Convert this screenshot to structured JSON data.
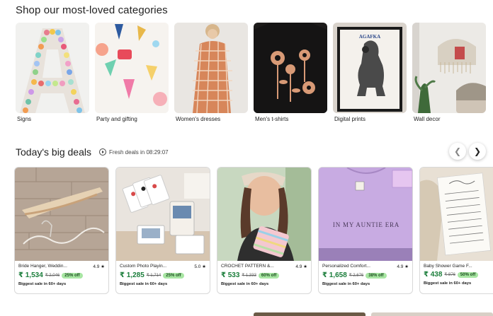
{
  "categories_section": {
    "title": "Shop our most-loved categories",
    "items": [
      {
        "label": "Signs"
      },
      {
        "label": "Party and gifting"
      },
      {
        "label": "Women's dresses"
      },
      {
        "label": "Men's t-shirts"
      },
      {
        "label": "Digital prints"
      },
      {
        "label": "Wall decor"
      }
    ]
  },
  "deals_section": {
    "title": "Today's big deals",
    "fresh_text": "Fresh deals in 08:29:07",
    "prev_icon": "chevron-left-icon",
    "next_icon": "chevron-right-icon",
    "items": [
      {
        "title": "Bride Hanger, Weddin...",
        "rating": "4.9 ★",
        "price": "₹ 1,534",
        "original": "₹ 2,046",
        "discount": "25% off",
        "note": "Biggest sale in 60+ days"
      },
      {
        "title": "Custom Photo Playin...",
        "rating": "5.0 ★",
        "price": "₹ 1,285",
        "original": "₹ 1,714",
        "discount": "25% off",
        "note": "Biggest sale in 60+ days"
      },
      {
        "title": "CROCHET PATTERN &...",
        "rating": "4.9 ★",
        "price": "₹ 533",
        "original": "₹ 1,333",
        "discount": "60% off",
        "note": "Biggest sale in 60+ days"
      },
      {
        "title": "Personalized Comfort...",
        "rating": "4.9 ★",
        "price": "₹ 1,658",
        "original": "₹ 2,676",
        "discount": "38% off",
        "note": "Biggest sale in 60+ days",
        "image_text": "IN MY AUNTIE ERA"
      },
      {
        "title": "Baby Shower Game F...",
        "rating": "",
        "price": "₹ 438",
        "original": "₹ 876",
        "discount": "50% off",
        "note": "Biggest sale in 60+ days"
      }
    ]
  },
  "colors": {
    "price_green": "#1a7d3a",
    "badge_bg": "#a8e6a3"
  }
}
